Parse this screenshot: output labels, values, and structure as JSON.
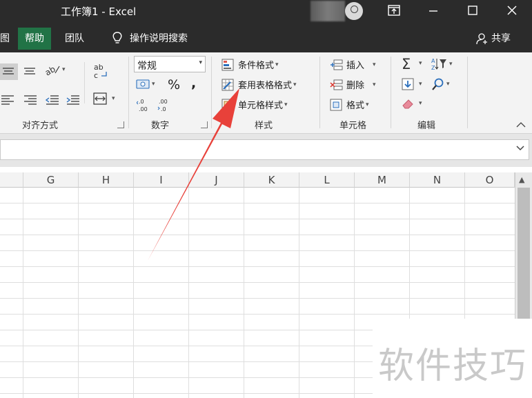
{
  "window": {
    "title": "工作簿1  -  Excel"
  },
  "menubar": {
    "items": [
      {
        "label": "图"
      },
      {
        "label": "帮助"
      },
      {
        "label": "团队"
      },
      {
        "label": "操作说明搜索"
      }
    ],
    "share_label": "共享"
  },
  "ribbon": {
    "groups": {
      "alignment": {
        "label": "对齐方式"
      },
      "number": {
        "label": "数字",
        "format_value": "常规",
        "percent_label": "%",
        "comma_label": ","
      },
      "styles": {
        "label": "样式",
        "conditional_format": "条件格式",
        "format_as_table": "套用表格格式",
        "cell_styles": "单元格样式"
      },
      "cells": {
        "label": "单元格",
        "insert": "插入",
        "delete": "删除",
        "format": "格式"
      },
      "editing": {
        "label": "编辑"
      }
    }
  },
  "grid": {
    "columns": [
      "G",
      "H",
      "I",
      "J",
      "K",
      "L",
      "M",
      "N",
      "O"
    ]
  },
  "watermark": {
    "text": "软件技巧"
  },
  "colors": {
    "titlebar": "#2b2b2b",
    "accent": "#217346",
    "arrow": "#e8413a"
  }
}
